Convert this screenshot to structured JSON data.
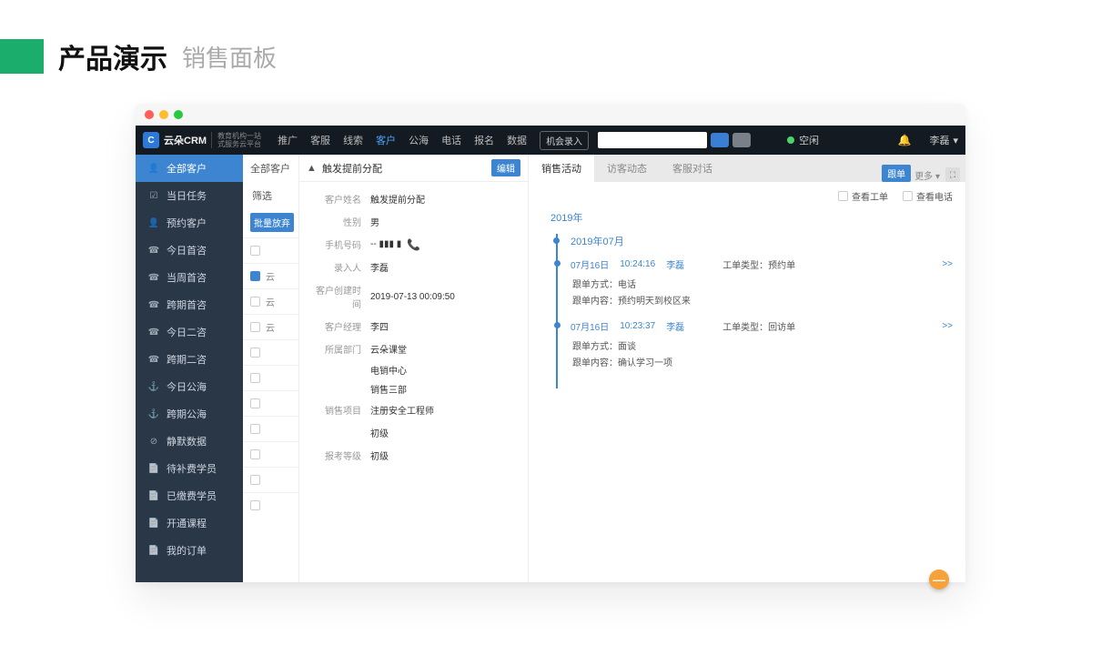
{
  "page": {
    "title": "产品演示",
    "subtitle": "销售面板"
  },
  "topbar": {
    "brand": "云朵CRM",
    "brandSub1": "教育机构一站",
    "brandSub2": "式服务云平台",
    "nav": [
      "推广",
      "客服",
      "线索",
      "客户",
      "公海",
      "电话",
      "报名",
      "数据"
    ],
    "navActiveIndex": 3,
    "recordBtn": "机会录入",
    "status": "空闲",
    "user": "李磊"
  },
  "sidebar": {
    "items": [
      {
        "icon": "👤",
        "label": "全部客户",
        "active": true
      },
      {
        "icon": "☑",
        "label": "当日任务"
      },
      {
        "icon": "👤",
        "label": "预约客户"
      },
      {
        "icon": "☎",
        "label": "今日首咨"
      },
      {
        "icon": "☎",
        "label": "当周首咨"
      },
      {
        "icon": "☎",
        "label": "跨期首咨"
      },
      {
        "icon": "☎",
        "label": "今日二咨"
      },
      {
        "icon": "☎",
        "label": "跨期二咨"
      },
      {
        "icon": "⚓",
        "label": "今日公海"
      },
      {
        "icon": "⚓",
        "label": "跨期公海"
      },
      {
        "icon": "⊘",
        "label": "静默数据"
      },
      {
        "icon": "📄",
        "label": "待补费学员"
      },
      {
        "icon": "📄",
        "label": "已缴费学员"
      },
      {
        "icon": "📄",
        "label": "开通课程"
      },
      {
        "icon": "📄",
        "label": "我的订单"
      }
    ]
  },
  "mid": {
    "head": "全部客户",
    "filter": "筛选",
    "batch": "批量放弃",
    "rows": [
      "",
      "云",
      "云",
      "云",
      "",
      "",
      "",
      "",
      "",
      "",
      ""
    ]
  },
  "detail": {
    "title": "触发提前分配",
    "edit": "编辑",
    "fields": [
      {
        "label": "客户姓名",
        "value": "触发提前分配"
      },
      {
        "label": "性别",
        "value": "男"
      },
      {
        "label": "手机号码",
        "value": "-- ▮▮▮ ▮",
        "phone": true
      },
      {
        "label": "录入人",
        "value": "李磊"
      },
      {
        "label": "客户创建时间",
        "value": "2019-07-13 00:09:50"
      },
      {
        "label": "客户经理",
        "value": "李四"
      },
      {
        "label": "所属部门",
        "value": "云朵课堂"
      }
    ],
    "extra": [
      "电销中心",
      "销售三部"
    ],
    "fields2": [
      {
        "label": "销售项目",
        "value": "注册安全工程师"
      },
      {
        "label": "",
        "value": "初级"
      },
      {
        "label": "报考等级",
        "value": "初级"
      }
    ]
  },
  "right": {
    "tabs": [
      "销售活动",
      "访客动态",
      "客服对话"
    ],
    "tabActive": 0,
    "follow": "跟单",
    "more": "更多",
    "checks": [
      "查看工单",
      "查看电话"
    ],
    "year": "2019年",
    "month": "2019年07月",
    "entries": [
      {
        "date": "07月16日",
        "time": "10:24:16",
        "person": "李磊",
        "typeLabel": "工单类型：",
        "type": "预约单",
        "expand": ">>",
        "lines": [
          {
            "k": "跟单方式：",
            "v": "电话"
          },
          {
            "k": "跟单内容：",
            "v": "预约明天到校区来"
          }
        ]
      },
      {
        "date": "07月16日",
        "time": "10:23:37",
        "person": "李磊",
        "typeLabel": "工单类型：",
        "type": "回访单",
        "expand": ">>",
        "lines": [
          {
            "k": "跟单方式：",
            "v": "面谈"
          },
          {
            "k": "跟单内容：",
            "v": "确认学习一项"
          }
        ]
      }
    ]
  }
}
